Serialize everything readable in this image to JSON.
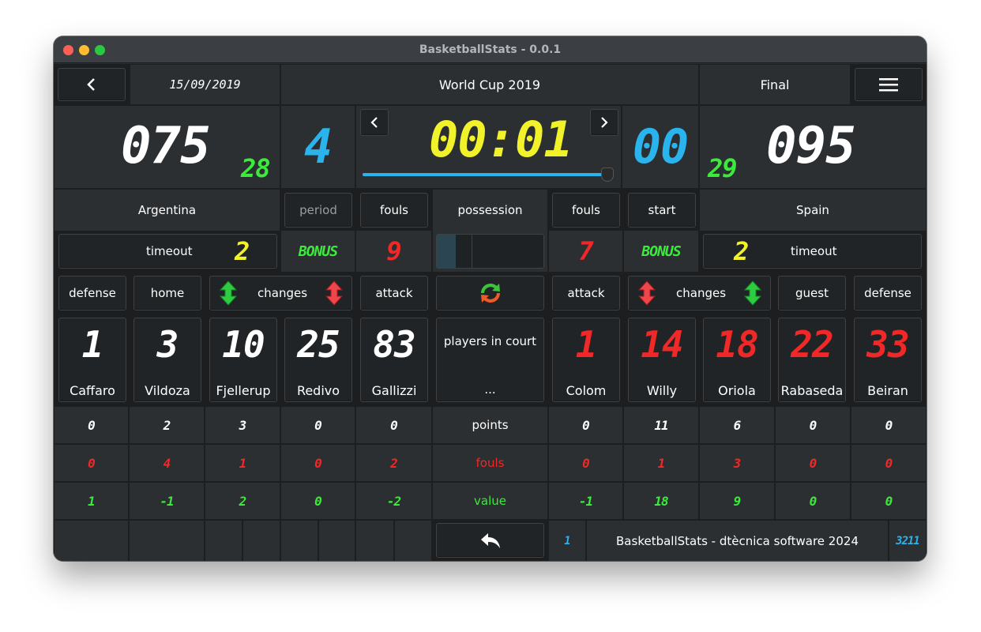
{
  "window": {
    "title": "BasketballStats - 0.0.1"
  },
  "header": {
    "date": "15/09/2019",
    "event": "World Cup 2019",
    "phase": "Final"
  },
  "scoreboard": {
    "home_score": "075",
    "home_sub": "28",
    "period": "4",
    "clock": "00:01",
    "guest_period_box": "00",
    "guest_sub": "29",
    "guest_score": "095",
    "clock_progress": 1.0
  },
  "labels": {
    "period": "period",
    "fouls": "fouls",
    "possession": "possession",
    "start": "start",
    "timeout": "timeout",
    "bonus": "BONUS",
    "defense": "defense",
    "home": "home",
    "guest": "guest",
    "changes": "changes",
    "attack": "attack",
    "players_in_court": "players in court",
    "ellipsis": "...",
    "points": "points",
    "fouls_row": "fouls",
    "value": "value"
  },
  "home": {
    "name": "Argentina",
    "timeouts": "2",
    "team_fouls": "9",
    "players": [
      {
        "number": "1",
        "name": "Caffaro",
        "points": "0",
        "fouls": "0",
        "value": "1"
      },
      {
        "number": "3",
        "name": "Vildoza",
        "points": "2",
        "fouls": "4",
        "value": "-1"
      },
      {
        "number": "10",
        "name": "Fjellerup",
        "points": "3",
        "fouls": "1",
        "value": "2"
      },
      {
        "number": "25",
        "name": "Redivo",
        "points": "0",
        "fouls": "0",
        "value": "0"
      },
      {
        "number": "83",
        "name": "Gallizzi",
        "points": "0",
        "fouls": "2",
        "value": "-2"
      }
    ]
  },
  "guest": {
    "name": "Spain",
    "timeouts": "2",
    "team_fouls": "7",
    "players": [
      {
        "number": "1",
        "name": "Colom",
        "points": "0",
        "fouls": "0",
        "value": "-1"
      },
      {
        "number": "14",
        "name": "Willy",
        "points": "11",
        "fouls": "1",
        "value": "18"
      },
      {
        "number": "18",
        "name": "Oriola",
        "points": "6",
        "fouls": "3",
        "value": "9"
      },
      {
        "number": "22",
        "name": "Rabaseda",
        "points": "0",
        "fouls": "0",
        "value": "0"
      },
      {
        "number": "33",
        "name": "Beiran",
        "points": "0",
        "fouls": "0",
        "value": "0"
      }
    ]
  },
  "footer": {
    "left_count": "1",
    "credits": "BasketballStats - dtècnica software 2024",
    "right_count": "3211"
  },
  "colors": {
    "accent_blue": "#2ab4ee",
    "lcd_green": "#3bea3b",
    "lcd_red": "#f02828",
    "lcd_yellow": "#f2f22b"
  },
  "icons": {
    "back": "chevron-left-icon",
    "menu": "hamburger-menu-icon",
    "swap": "swap-possession-icon",
    "undo": "undo-icon"
  }
}
